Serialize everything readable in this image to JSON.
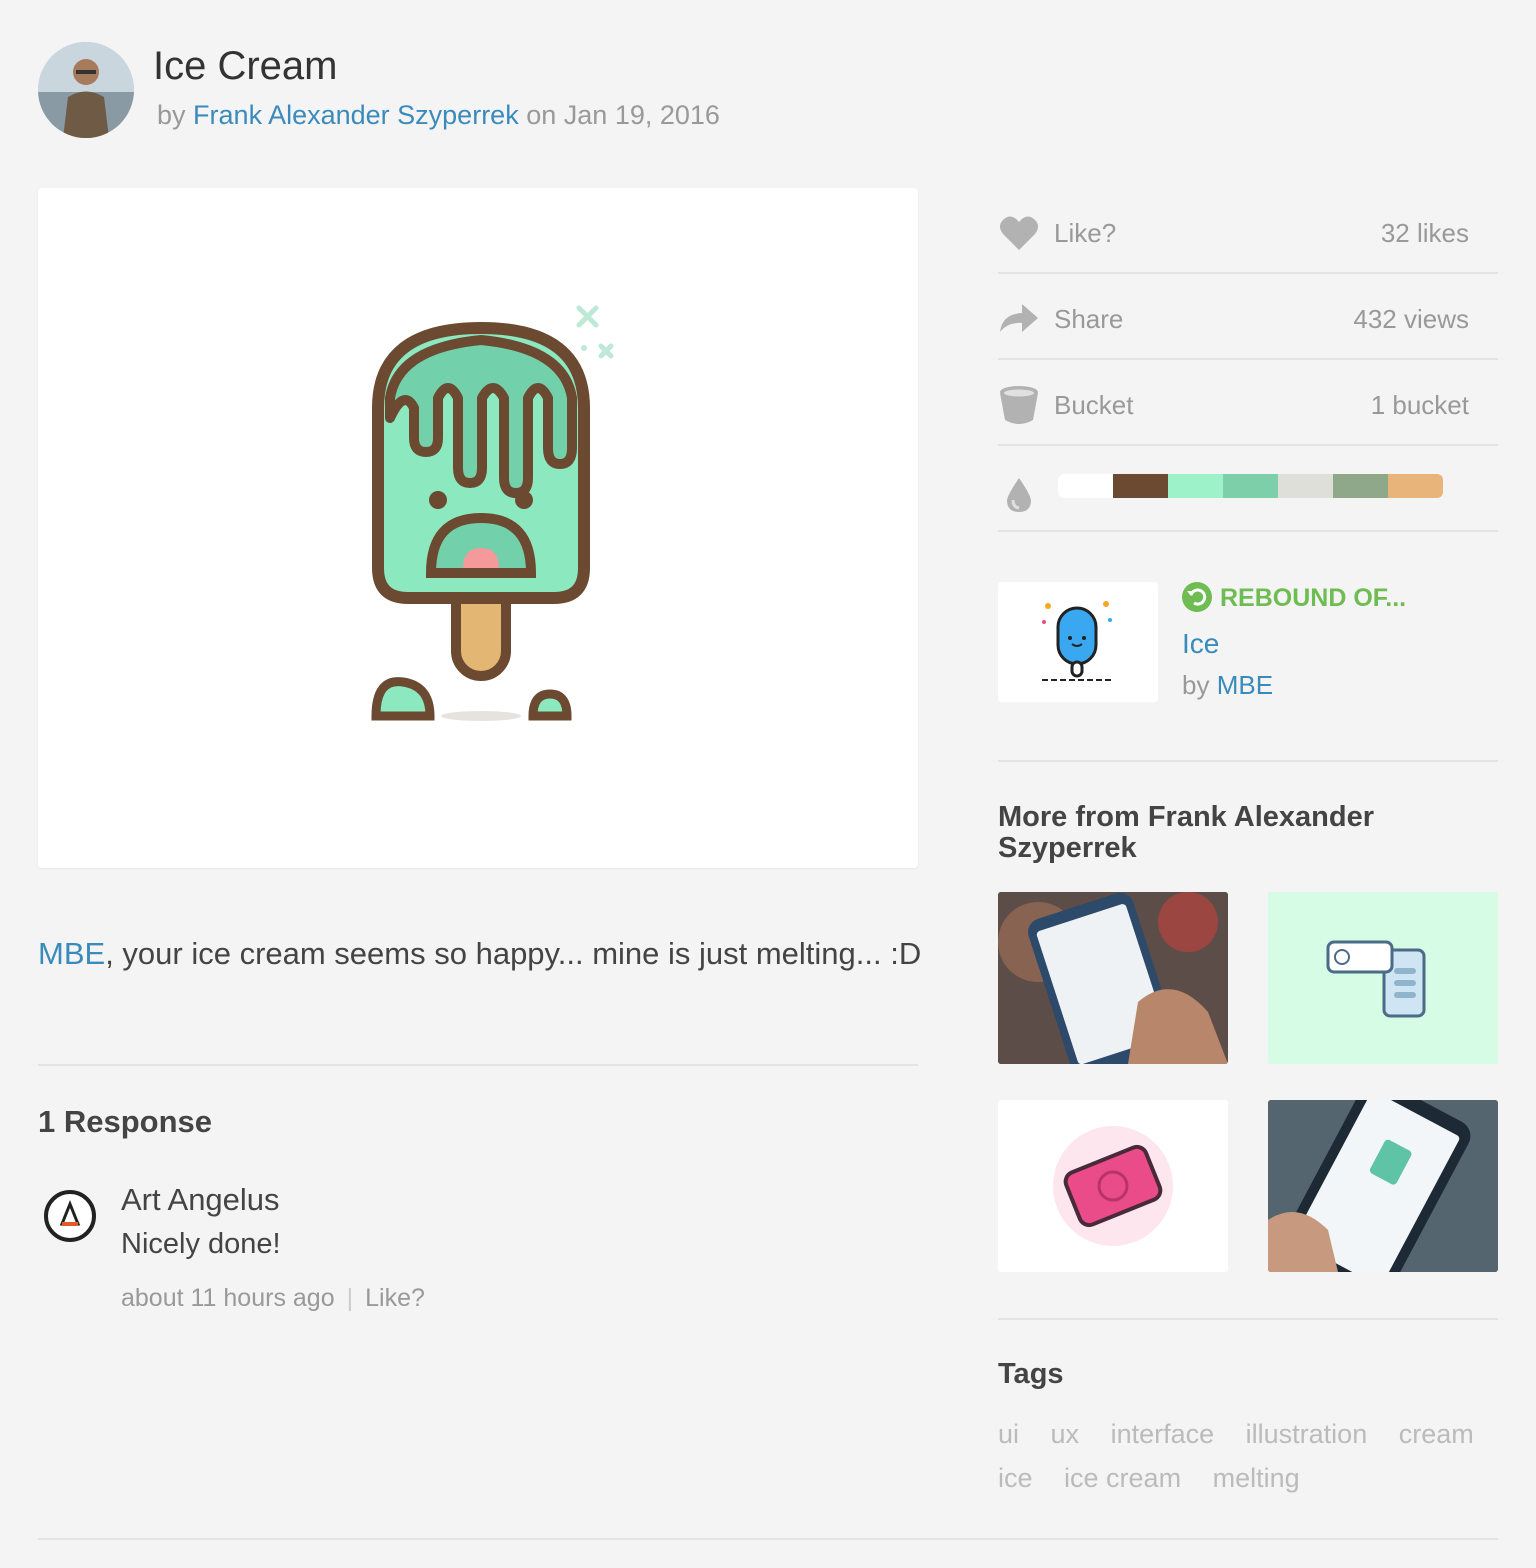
{
  "shot": {
    "title": "Ice Cream",
    "by_label": "by",
    "author": "Frank Alexander Szyperrek",
    "on_label": "on",
    "date": "Jan 19, 2016"
  },
  "description": {
    "mention": "MBE",
    "text": ", your ice cream seems so happy... mine is just melting... :D"
  },
  "responses": {
    "title": "1 Response",
    "items": [
      {
        "name": "Art Angelus",
        "text": "Nicely done!",
        "time": "about 11 hours ago",
        "like": "Like?"
      }
    ]
  },
  "stats": {
    "like_label": "Like?",
    "likes": "32 likes",
    "share_label": "Share",
    "views": "432 views",
    "bucket_label": "Bucket",
    "buckets": "1 bucket"
  },
  "palette": [
    "#ffffff",
    "#6b4a31",
    "#9ef2c9",
    "#7ccfa9",
    "#dedfd9",
    "#8fa88a",
    "#e8b479"
  ],
  "rebound": {
    "label": "REBOUND OF...",
    "title": "Ice",
    "by_label": "by",
    "author": "MBE"
  },
  "more": {
    "title": "More from Frank Alexander Szyperrek"
  },
  "tags": {
    "title": "Tags",
    "items": [
      "ui",
      "ux",
      "interface",
      "illustration",
      "cream",
      "ice",
      "ice cream",
      "melting"
    ]
  },
  "colors": {
    "link": "#3a8bbb",
    "rebound": "#6fbd52",
    "muted": "#999999"
  }
}
